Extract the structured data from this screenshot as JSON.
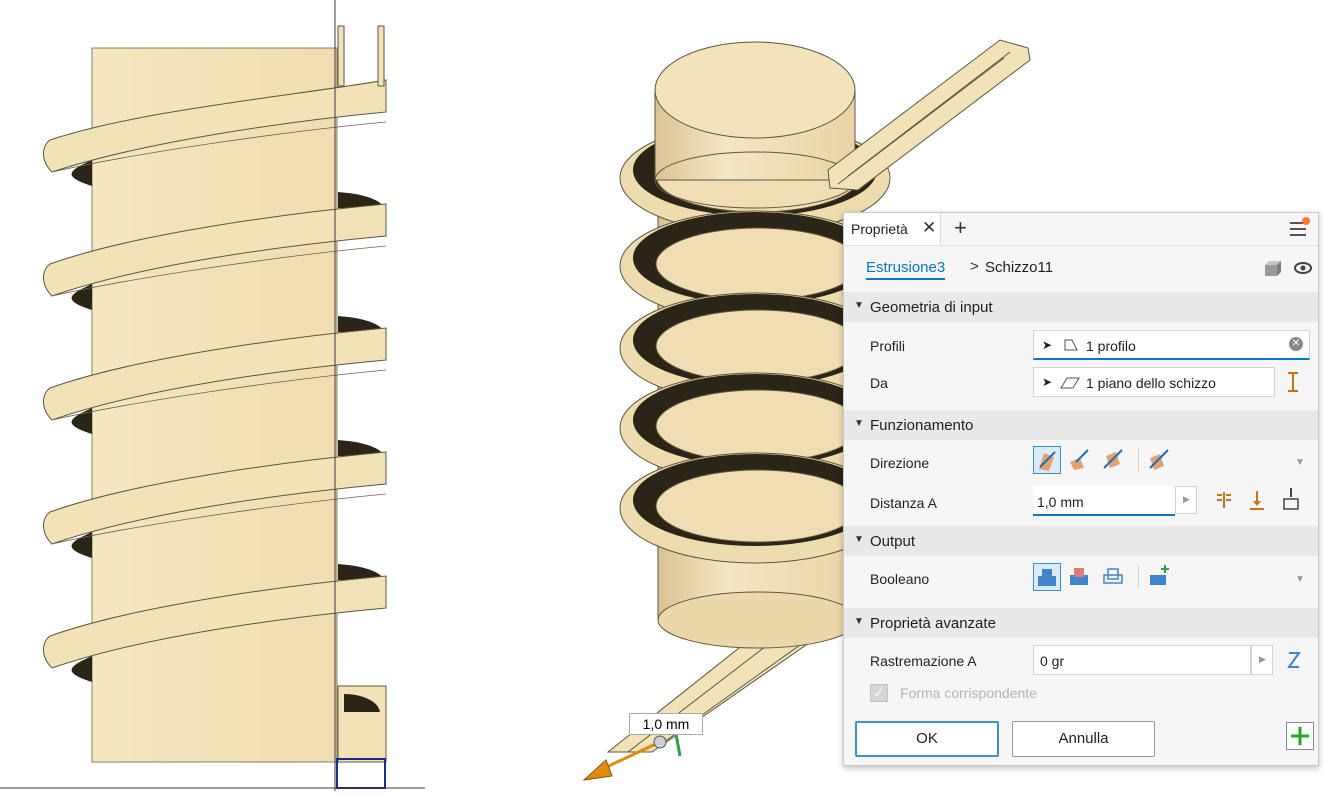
{
  "panel": {
    "tab_label": "Proprietà",
    "breadcrumb": {
      "parent": "Estrusione3",
      "separator": ">",
      "current": "Schizzo11"
    },
    "sections": {
      "input_geometry": {
        "title": "Geometria di input",
        "profiles_label": "Profili",
        "profiles_value": "1 profilo",
        "from_label": "Da",
        "from_value": "1 piano dello schizzo"
      },
      "operation": {
        "title": "Funzionamento",
        "direction_label": "Direzione",
        "distance_label": "Distanza A",
        "distance_value": "1,0 mm"
      },
      "output": {
        "title": "Output",
        "boolean_label": "Booleano"
      },
      "advanced": {
        "title": "Proprietà avanzate",
        "taper_label": "Rastremazione A",
        "taper_value": "0 gr",
        "match_shape_label": "Forma corrispondente"
      }
    },
    "buttons": {
      "ok": "OK",
      "cancel": "Annulla"
    }
  },
  "viewport": {
    "dimension_label": "1,0 mm"
  },
  "colors": {
    "accent": "#0a76c4",
    "model_face": "#f2e2b8",
    "model_shadow": "#2b2517",
    "arrow": "#e08a10",
    "add_green": "#29a329"
  }
}
